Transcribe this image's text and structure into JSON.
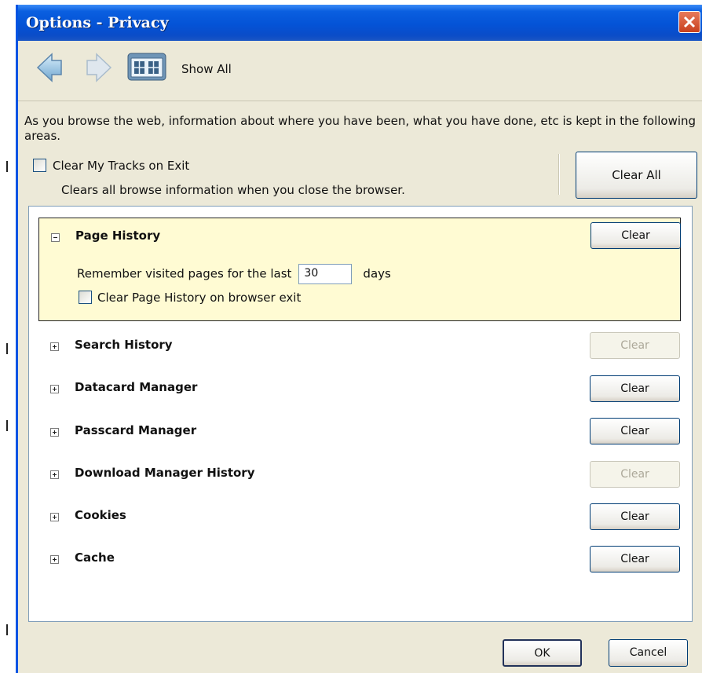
{
  "window": {
    "title": "Options - Privacy"
  },
  "toolbar": {
    "show_all_label": "Show All"
  },
  "intro_text": "As you browse the web, information about where you have been, what you have done, etc is kept in the following areas.",
  "clear_on_exit": {
    "label": "Clear My Tracks on Exit",
    "description": "Clears all browse information when you close the browser.",
    "checked": false
  },
  "clear_all_label": "Clear All",
  "page_history": {
    "title": "Page History",
    "clear_label": "Clear",
    "remember_prefix": "Remember visited pages for the last",
    "days_value": "30",
    "days_suffix": "days",
    "exit_checkbox_label": "Clear Page History on browser exit",
    "exit_checked": false
  },
  "sections": [
    {
      "title": "Search History",
      "clear_label": "Clear",
      "enabled": false
    },
    {
      "title": "Datacard Manager",
      "clear_label": "Clear",
      "enabled": true
    },
    {
      "title": "Passcard Manager",
      "clear_label": "Clear",
      "enabled": true
    },
    {
      "title": "Download Manager History",
      "clear_label": "Clear",
      "enabled": false
    },
    {
      "title": "Cookies",
      "clear_label": "Clear",
      "enabled": true
    },
    {
      "title": "Cache",
      "clear_label": "Clear",
      "enabled": true
    }
  ],
  "footer": {
    "ok_label": "OK",
    "cancel_label": "Cancel"
  },
  "icons": {
    "close": "close-icon",
    "back": "back-arrow-icon",
    "forward": "forward-arrow-icon",
    "show_all": "show-all-icon",
    "expanded": "minus-expander-icon",
    "collapsed": "plus-expander-icon"
  },
  "colors": {
    "titlebar": "#0453d6",
    "dialog_bg": "#ece9d8",
    "highlight_bg": "#fffbd3",
    "close_button": "#d1492a"
  }
}
